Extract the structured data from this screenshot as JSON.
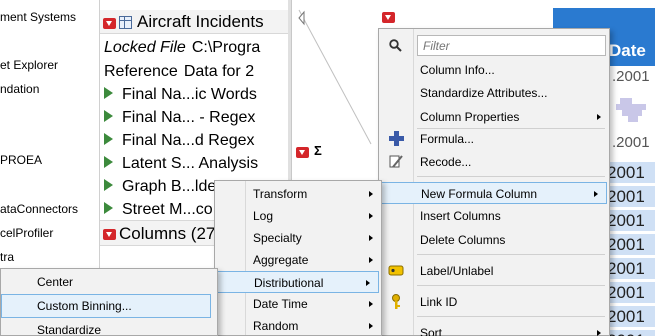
{
  "left_tree": {
    "items": [
      "ment Systems",
      "et Explorer",
      "ndation",
      "PROEA",
      "ataConnectors",
      "celProfiler",
      "tra"
    ]
  },
  "table_panel": {
    "title": "Aircraft Incidents",
    "locked_label": "Locked File",
    "locked_value": "C:\\Progra",
    "reference_label": "Reference",
    "reference_value": "Data for 2",
    "scripts": [
      "Final Na...ic Words",
      "Final Na... - Regex",
      "Final Na...d Regex",
      "Latent S... Analysis",
      "Graph B...lde",
      "Street M...co"
    ]
  },
  "columns_panel": {
    "title": "Columns (27"
  },
  "grid": {
    "date_header": "Date",
    "sigma": "Σ",
    "date_cells_gray": [
      ".2001",
      ".2001"
    ],
    "date_cells_blue": [
      "2001",
      "2001",
      "2001",
      "2001",
      "2001",
      "2001",
      "2001",
      "2001"
    ]
  },
  "columns_menu": {
    "filter_placeholder": "Filter",
    "items": [
      {
        "label": "Column Info...",
        "submenu": false
      },
      {
        "label": "Standardize Attributes...",
        "submenu": false
      },
      {
        "label": "Column Properties",
        "submenu": true
      },
      {
        "label": "Formula...",
        "submenu": false,
        "icon": "plus-icon"
      },
      {
        "label": "Recode...",
        "submenu": false,
        "icon": "recode-icon"
      },
      {
        "label": "New Formula Column",
        "submenu": true,
        "highlight": true
      },
      {
        "label": "Insert Columns",
        "submenu": false
      },
      {
        "label": "Delete Columns",
        "submenu": false
      },
      {
        "label": "Label/Unlabel",
        "submenu": false,
        "icon": "label-icon"
      },
      {
        "label": "Link ID",
        "submenu": false,
        "icon": "key-icon"
      },
      {
        "label": "Sort",
        "submenu": true
      }
    ]
  },
  "formula_submenu": {
    "items": [
      {
        "label": "Transform",
        "submenu": true
      },
      {
        "label": "Log",
        "submenu": true
      },
      {
        "label": "Specialty",
        "submenu": true
      },
      {
        "label": "Aggregate",
        "submenu": true
      },
      {
        "label": "Distributional",
        "submenu": true,
        "highlight": true
      },
      {
        "label": "Date Time",
        "submenu": true
      },
      {
        "label": "Random",
        "submenu": true
      }
    ]
  },
  "distrib_submenu": {
    "items": [
      {
        "label": "Center",
        "highlight": false
      },
      {
        "label": "Custom Binning...",
        "highlight": true
      },
      {
        "label": "Standardize",
        "highlight": false
      }
    ]
  },
  "colors": {
    "accent_blue": "#2a7ad0",
    "red_button": "#d4262a",
    "row_blue": "#cfe0f5",
    "highlight_border": "#7ab4e4"
  }
}
